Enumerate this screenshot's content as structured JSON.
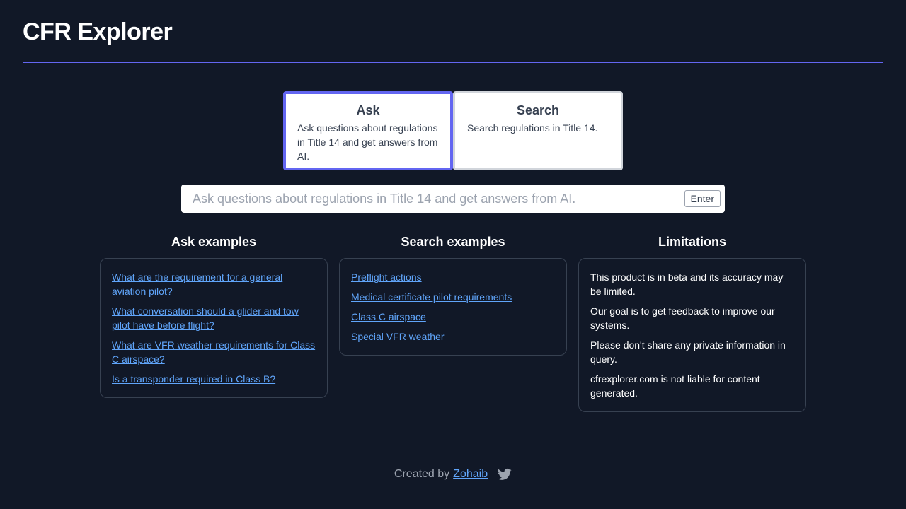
{
  "header": {
    "title": "CFR Explorer"
  },
  "modes": {
    "ask": {
      "title": "Ask",
      "description": "Ask questions about regulations in Title 14 and get answers from AI."
    },
    "search": {
      "title": "Search",
      "description": "Search regulations in Title 14."
    }
  },
  "query": {
    "placeholder": "Ask questions about regulations in Title 14 and get answers from AI.",
    "value": "",
    "enter_label": "Enter"
  },
  "ask_examples": {
    "heading": "Ask examples",
    "items": [
      "What are the requirement for a general aviation pilot?",
      "What conversation should a glider and tow pilot have before flight?",
      "What are VFR weather requirements for Class C airspace?",
      "Is a transponder required in Class B?"
    ]
  },
  "search_examples": {
    "heading": "Search examples",
    "items": [
      "Preflight actions",
      "Medical certificate pilot requirements",
      "Class C airspace",
      "Special VFR weather"
    ]
  },
  "limitations": {
    "heading": "Limitations",
    "items": [
      "This product is in beta and its accuracy may be limited.",
      "Our goal is to get feedback to improve our systems.",
      "Please don't share any private information in query.",
      "cfrexplorer.com is not liable for content generated."
    ]
  },
  "footer": {
    "created_by": "Created by",
    "author": "Zohaib",
    "social_icon": "twitter-icon"
  },
  "colors": {
    "background": "#111827",
    "accent": "#6366f1",
    "link": "#60a5fa"
  }
}
